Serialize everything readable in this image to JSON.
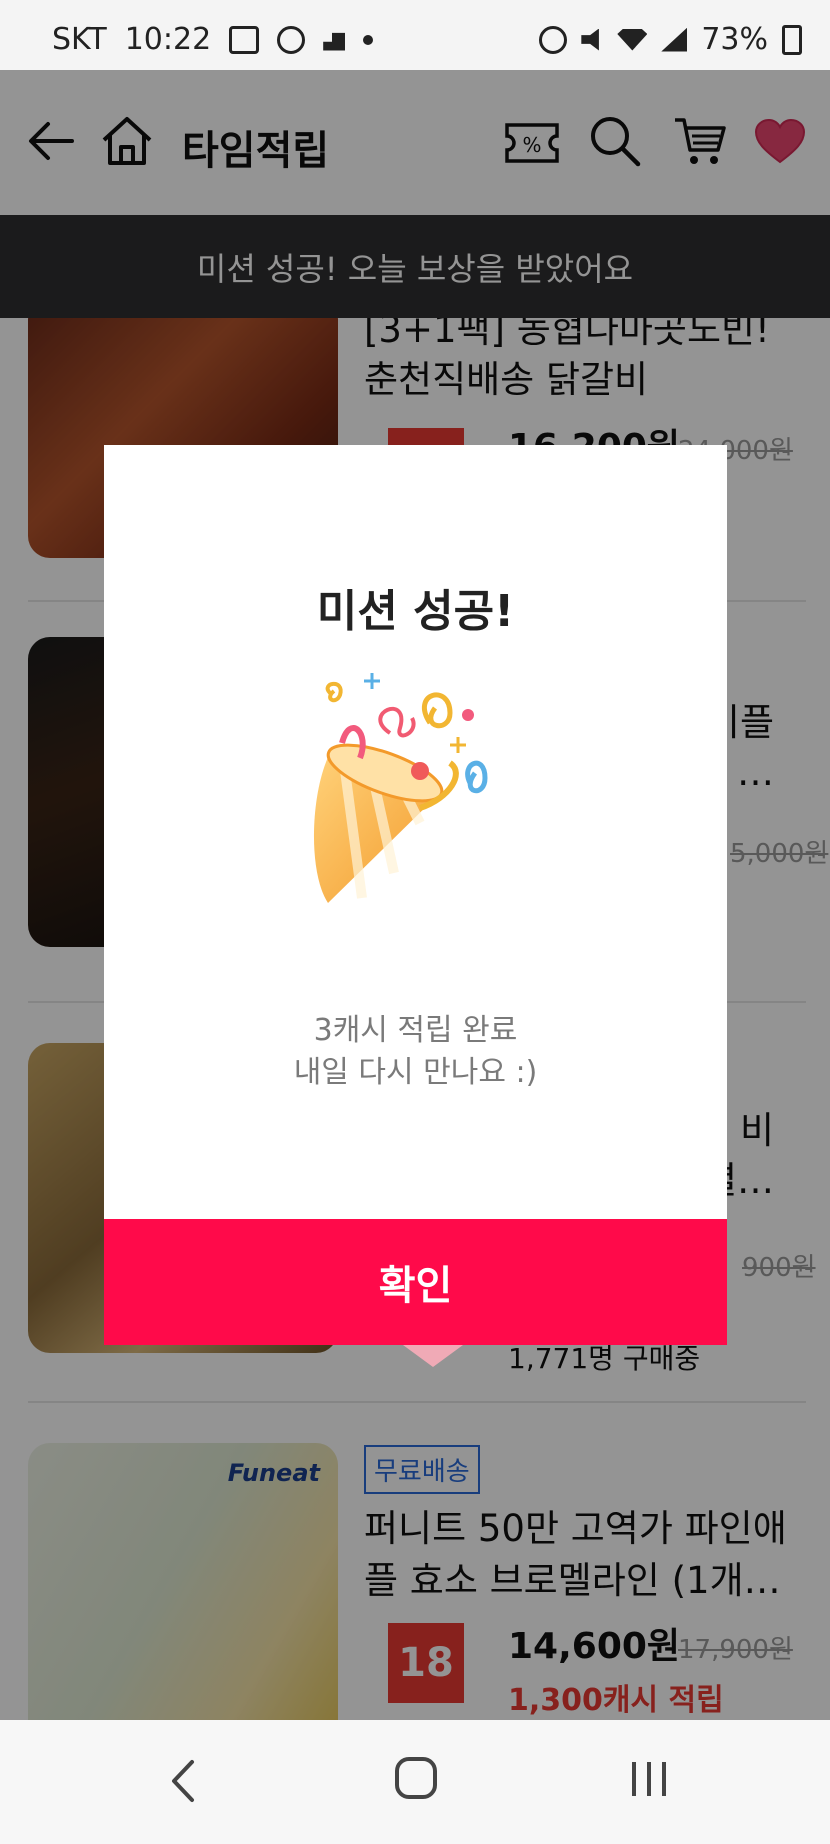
{
  "status_bar": {
    "carrier": "SKT",
    "time": "10:22",
    "battery": "73%"
  },
  "header": {
    "title": "타임적립"
  },
  "toast": {
    "text": "미션 성공! 오늘 보상을 받았어요"
  },
  "list": {
    "items": [
      {
        "title_line1": "[3+1팩] 농협다마곳노빈!",
        "title_line2": "춘천직배송 닭갈비",
        "price": "16,200원",
        "original_price": "24,000원"
      },
      {
        "title_right": "비플",
        "title_more": "…",
        "original_price": "5,000원"
      },
      {
        "title_right": "비",
        "title_more": "별…",
        "original_price": "900원",
        "buyers": "1,771명 구매중"
      },
      {
        "free_shipping": "무료배송",
        "title_line1": "퍼니트 50만 고역가 파인애",
        "title_line2": "플 효소 브로멜라인 (1개…",
        "price": "14,600원",
        "original_price": "17,900원",
        "discount": "18",
        "cash": "1,300캐시 적립",
        "thumb_brand": "Funeat"
      }
    ]
  },
  "modal": {
    "title": "미션 성공!",
    "message_line1": "3캐시 적립 완료",
    "message_line2": "내일 다시 만나요 :)",
    "confirm_label": "확인"
  }
}
